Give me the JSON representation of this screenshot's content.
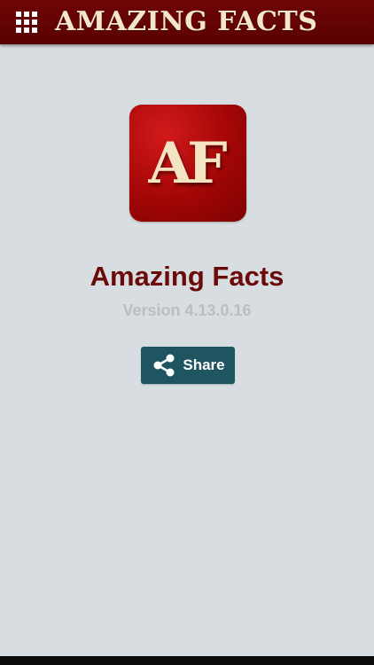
{
  "header": {
    "title": "AMAZING FACTS",
    "menu_icon": "apps-grid-icon",
    "background_color": "#5e0303",
    "title_color": "#f3e6cf"
  },
  "about": {
    "logo_text": "AF",
    "logo_color": "#b00808",
    "app_name": "Amazing Facts",
    "app_name_color": "#6a0a0a",
    "version": "Version 4.13.0.16",
    "version_color": "#b9bec2"
  },
  "share": {
    "label": "Share",
    "icon": "share-icon",
    "background_color": "#1e5560"
  }
}
